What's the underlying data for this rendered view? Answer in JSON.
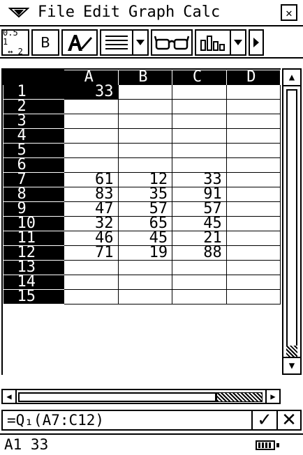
{
  "menubar": {
    "items": [
      "File",
      "Edit",
      "Graph",
      "Calc"
    ],
    "close_label": "✕"
  },
  "toolbar": {
    "fraction_label_top": "0.5 1",
    "fraction_label_bottom": "↔ 2",
    "bold_label": "B"
  },
  "sheet": {
    "columns": [
      "A",
      "B",
      "C",
      "D"
    ],
    "rows": [
      {
        "num": "1",
        "cells": [
          "33",
          "",
          "",
          ""
        ]
      },
      {
        "num": "2",
        "cells": [
          "",
          "",
          "",
          ""
        ]
      },
      {
        "num": "3",
        "cells": [
          "",
          "",
          "",
          ""
        ]
      },
      {
        "num": "4",
        "cells": [
          "",
          "",
          "",
          ""
        ]
      },
      {
        "num": "5",
        "cells": [
          "",
          "",
          "",
          ""
        ]
      },
      {
        "num": "6",
        "cells": [
          "",
          "",
          "",
          ""
        ]
      },
      {
        "num": "7",
        "cells": [
          "61",
          "12",
          "33",
          ""
        ]
      },
      {
        "num": "8",
        "cells": [
          "83",
          "35",
          "91",
          ""
        ]
      },
      {
        "num": "9",
        "cells": [
          "47",
          "57",
          "57",
          ""
        ]
      },
      {
        "num": "10",
        "cells": [
          "32",
          "65",
          "45",
          ""
        ]
      },
      {
        "num": "11",
        "cells": [
          "46",
          "45",
          "21",
          ""
        ]
      },
      {
        "num": "12",
        "cells": [
          "71",
          "19",
          "88",
          ""
        ]
      },
      {
        "num": "13",
        "cells": [
          "",
          "",
          "",
          ""
        ]
      },
      {
        "num": "14",
        "cells": [
          "",
          "",
          "",
          ""
        ]
      },
      {
        "num": "15",
        "cells": [
          "",
          "",
          "",
          ""
        ]
      }
    ],
    "selected_cell": "A1"
  },
  "formula_bar": {
    "value": "=Q₁(A7:C12)",
    "accept_label": "✓",
    "cancel_label": "✕"
  },
  "status": {
    "text": "A1 33"
  }
}
